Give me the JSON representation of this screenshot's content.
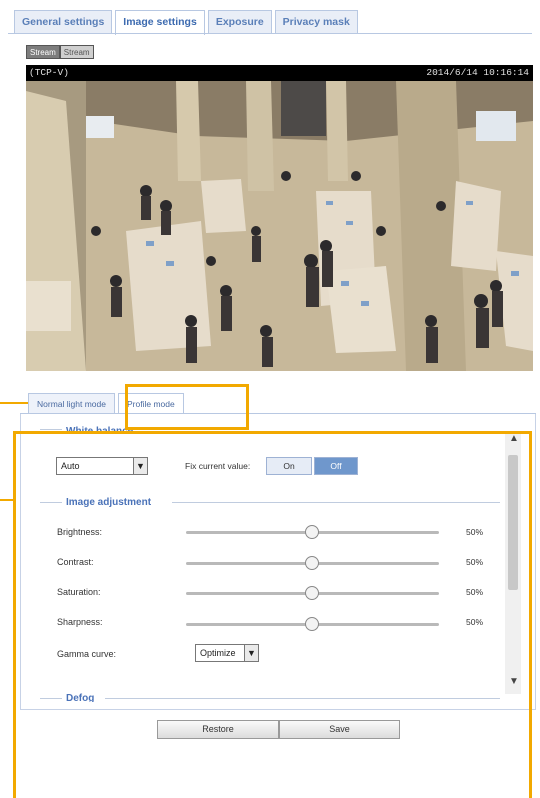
{
  "tabs": [
    {
      "label": "General settings"
    },
    {
      "label": "Image settings"
    },
    {
      "label": "Exposure"
    },
    {
      "label": "Privacy mask"
    }
  ],
  "stream": {
    "opt1": "Stream",
    "opt2": "Stream"
  },
  "video": {
    "left_text": "(TCP-V)",
    "timestamp": "2014/6/14 10:16:14"
  },
  "mode_tabs": [
    {
      "label": "Normal light mode"
    },
    {
      "label": "Profile mode"
    }
  ],
  "white_balance": {
    "title": "White balance",
    "select_value": "Auto",
    "fix_label": "Fix current value:",
    "on_label": "On",
    "off_label": "Off"
  },
  "image_adjustment": {
    "title": "Image adjustment",
    "rows": [
      {
        "label": "Brightness:",
        "value": "50%",
        "level": 0.5
      },
      {
        "label": "Contrast:",
        "value": "50%",
        "level": 0.5
      },
      {
        "label": "Saturation:",
        "value": "50%",
        "level": 0.5
      },
      {
        "label": "Sharpness:",
        "value": "50%",
        "level": 0.5
      }
    ],
    "gamma_label": "Gamma curve:",
    "gamma_value": "Optimize"
  },
  "defog": {
    "title": "Defog"
  },
  "buttons": {
    "restore": "Restore",
    "save": "Save"
  },
  "colors": {
    "accent": "#4a72b8",
    "callout": "#f2a900",
    "toggle_active": "#6f97cc"
  }
}
